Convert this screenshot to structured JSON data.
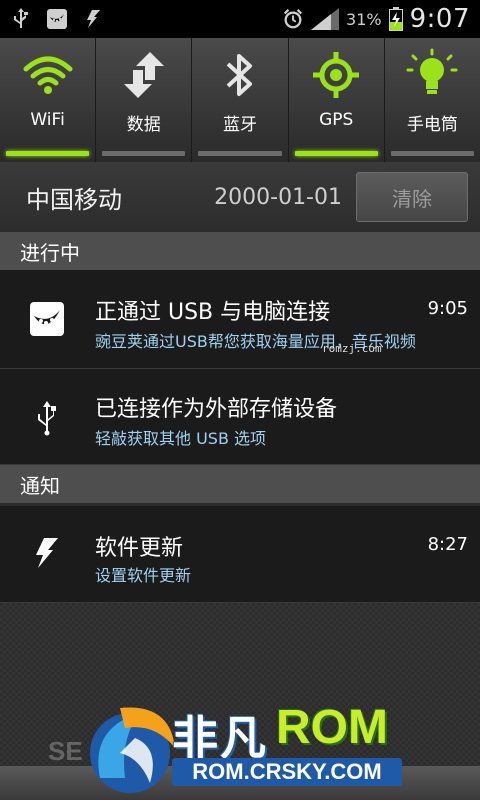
{
  "status_bar": {
    "left_icons": [
      "usb-icon",
      "wandoujia-icon",
      "software-update-icon"
    ],
    "right_icons": [
      "alarm-icon",
      "signal-icon",
      "battery-charging-icon"
    ],
    "battery_percent": "31%",
    "time": "9:07"
  },
  "toggles": [
    {
      "label": "WiFi",
      "icon": "wifi-icon",
      "on": true
    },
    {
      "label": "数据",
      "icon": "data-icon",
      "on": false
    },
    {
      "label": "蓝牙",
      "icon": "bluetooth-icon",
      "on": false
    },
    {
      "label": "GPS",
      "icon": "gps-icon",
      "on": true
    },
    {
      "label": "手电筒",
      "icon": "flashlight-icon",
      "on": false
    }
  ],
  "carrier": {
    "name": "中国移动",
    "date": "2000-01-01",
    "clear_label": "清除"
  },
  "sections": {
    "ongoing": "进行中",
    "notifications": "通知"
  },
  "ongoing_items": [
    {
      "title": "正通过 USB 与电脑连接",
      "subtitle": "豌豆荚通过USB帮您获取海量应用，音乐视频",
      "time": "9:05",
      "icon": "wandoujia-icon"
    },
    {
      "title": "已连接作为外部存储设备",
      "subtitle": "轻敲获取其他 USB 选项",
      "time": "",
      "icon": "usb-icon"
    }
  ],
  "notification_items": [
    {
      "title": "软件更新",
      "subtitle": "设置软件更新",
      "time": "8:27",
      "icon": "software-update-icon"
    }
  ],
  "watermarks": {
    "small": "romzj.com",
    "logo_cn": "非凡",
    "logo_rom": "ROM",
    "logo_url": "ROM.CRSKY.COM",
    "ghost": "SE"
  },
  "colors": {
    "accent_green": "#9be218",
    "subtitle_blue": "#9fd0ef",
    "logo_blue": "#1f5aa8"
  }
}
